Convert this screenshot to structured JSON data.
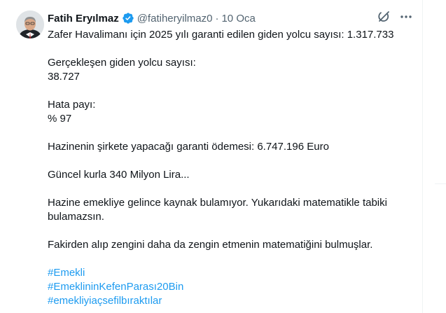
{
  "tweet": {
    "author_name": "Fatih Eryılmaz",
    "handle": "@fatiheryilmaz0",
    "separator": "·",
    "date": "10 Oca",
    "icons": [
      "verified-badge-icon",
      "grok-icon",
      "more-icon"
    ],
    "colors": {
      "verified": "#1d9bf0",
      "hashtag": "#1d9bf0",
      "secondary": "#536471"
    },
    "lines": [
      "Zafer Havalimanı için 2025 yılı garanti edilen giden yolcu sayısı: 1.317.733",
      "Gerçekleşen giden yolcu sayısı:",
      "38.727",
      "Hata payı:",
      "% 97",
      "Hazinenin şirkete yapacağı garanti ödemesi: 6.747.196 Euro",
      "Güncel kurla 340 Milyon Lira...",
      "Hazine emekliye gelince kaynak bulamıyor. Yukarıdaki matematikle tabiki",
      "bulamazsın.",
      "Fakirden alıp zengini daha da zengin etmenin matematiğini bulmuşlar."
    ],
    "hashtags": [
      "#Emekli",
      "#EmeklininKefenParası20Bin",
      "#emekliyiaçsefilbıraktılar"
    ]
  }
}
